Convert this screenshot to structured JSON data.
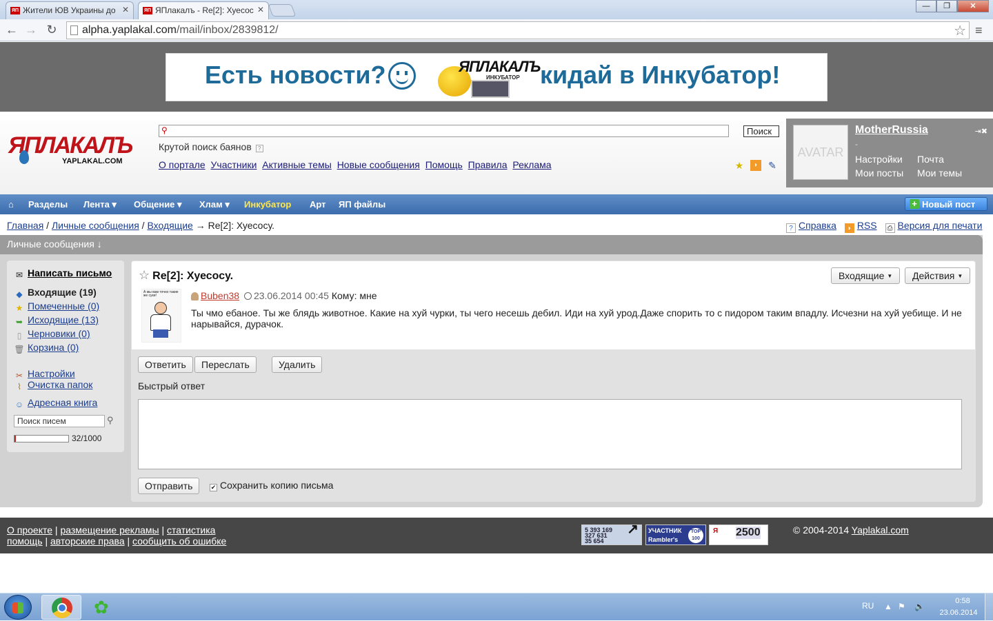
{
  "browser": {
    "tabs": [
      {
        "label": "Жители ЮВ Украины до",
        "active": false
      },
      {
        "label": "ЯПлакалъ - Re[2]: Хуесос",
        "active": true
      }
    ],
    "url_host": "alpha.yaplakal.com",
    "url_path": "/mail/inbox/2839812/"
  },
  "banner": {
    "text_left": "Есть новости?",
    "logo_text": "ЯПЛАКАЛЪ",
    "logo_sub": "ИНКУБАТОР",
    "text_right": "кидай в Инкубатор!"
  },
  "header": {
    "logo": "ЯПЛАКАЛЪ",
    "logo_sub": "YAPLAKAL.COM",
    "search_button": "Поиск",
    "search_hint": "Крутой поиск баянов",
    "links": [
      "О портале",
      "Участники",
      "Активные темы",
      "Новые сообщения",
      "Помощь",
      "Правила",
      "Реклама"
    ],
    "icons": [
      "star-icon",
      "rss-icon",
      "pencil-icon"
    ]
  },
  "user": {
    "avatar": "AVATAR",
    "name": "MotherRussia",
    "dash": "-",
    "links": [
      "Настройки",
      "Почта",
      "Мои посты",
      "Мои темы"
    ]
  },
  "nav": {
    "items": [
      "Разделы",
      "Лента",
      "Общение",
      "Хлам",
      "Инкубатор",
      "Арт",
      "ЯП файлы"
    ],
    "new_post": "Новый пост"
  },
  "breadcrumb": {
    "items": [
      "Главная",
      "Личные сообщения",
      "Входящие"
    ],
    "current": "Re[2]: Хуесосу."
  },
  "page_links": [
    "Справка",
    "RSS",
    "Версия для печати"
  ],
  "pm": {
    "header": "Личные сообщения ↓",
    "compose": "Написать письмо",
    "folders": [
      {
        "label": "Входящие (19)",
        "bold": true
      },
      {
        "label": "Помеченные (0)"
      },
      {
        "label": "Исходящие (13)"
      },
      {
        "label": "Черновики (0)"
      },
      {
        "label": "Корзина (0)"
      }
    ],
    "settings": "Настройки",
    "clean": "Очистка папок",
    "addressbook": "Адресная книга",
    "search_placeholder": "Поиск писем",
    "quota_text": "32/1000",
    "quota_fraction": 0.032
  },
  "message": {
    "subject": "Re[2]: Хуесосу.",
    "inbox_dropdown": "Входящие",
    "actions_dropdown": "Действия",
    "author": "Buben38",
    "date": "23.06.2014 00:45",
    "to": "Кому: мне",
    "avatar_caption": "А мы вам точно такие же суки!",
    "body": "Ты чмо ебаное. Ты же блядь животное. Какие на хуй чурки, ты чего несешь дебил. Иди на хуй урод.Даже спорить то с пидором таким впадлу. Исчезни на хуй уебище. И не нарывайся, дурачок.",
    "reply": "Ответить",
    "forward": "Переслать",
    "delete": "Удалить",
    "quick_reply": "Быстрый ответ",
    "send": "Отправить",
    "save_copy": "Сохранить копию письма"
  },
  "footer": {
    "line1": [
      "О проекте",
      "размещение рекламы",
      "статистика"
    ],
    "line2": [
      "помощь",
      "авторские права",
      "сообщить об ошибке"
    ],
    "counter1": [
      "5 393 169",
      "327 631",
      "35 654"
    ],
    "counter2": [
      "УЧАСТНИК",
      "Rambler's",
      "TOP 100"
    ],
    "counter3": [
      "Я",
      "2500"
    ],
    "copyright": "© 2004-2014",
    "copyright_link": "Yaplakal.com"
  },
  "taskbar": {
    "lang": "RU",
    "time": "0:58",
    "date": "23.06.2014"
  }
}
